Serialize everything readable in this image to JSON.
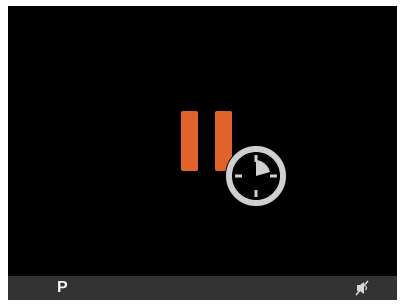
{
  "viewport": {
    "state": "paused-with-timer",
    "pause_icon": "pause-icon",
    "timer_icon": "clock-timer-icon",
    "accent_color": "#e0642a",
    "icon_color": "#d0d0d0"
  },
  "status_bar": {
    "mode_label": "P",
    "mute_icon": "speaker-muted-icon",
    "background": "#333333"
  }
}
